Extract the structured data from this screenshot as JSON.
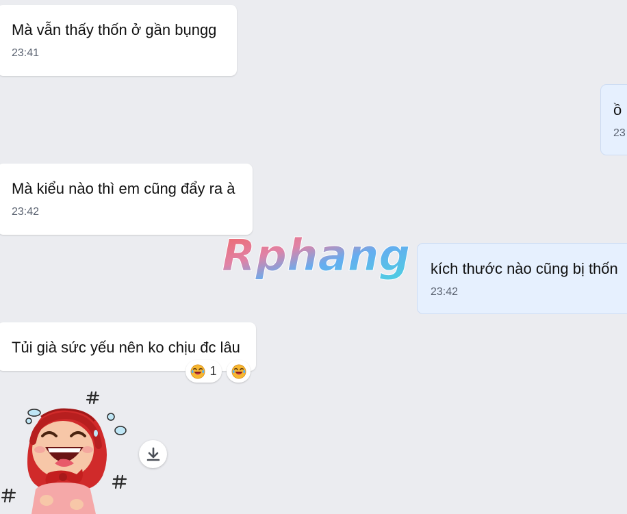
{
  "messages": [
    {
      "text": "Mà vẫn thấy thốn ở gần bụngg",
      "time": "23:41"
    },
    {
      "text": "ồ",
      "time": "23"
    },
    {
      "text": "Mà kiểu nào thì em cũng đẩy ra à",
      "time": "23:42"
    },
    {
      "text": "kích thước nào cũng bị thốn",
      "time": "23:42"
    },
    {
      "text": "Tủi già sức yếu nên ko chịu đc lâu"
    }
  ],
  "reactions": [
    {
      "emoji": "laughing-crying-emoji",
      "count": "1"
    },
    {
      "emoji": "laughing-crying-emoji"
    }
  ],
  "watermark": {
    "text": "Rphang"
  },
  "sticker": {
    "name": "crying-laughing-red-hood-girl-sticker"
  },
  "colors": {
    "background": "#ebecf0",
    "received_bubble": "#ffffff",
    "sent_bubble": "#e6f0fe",
    "time_text": "#5a6270"
  }
}
